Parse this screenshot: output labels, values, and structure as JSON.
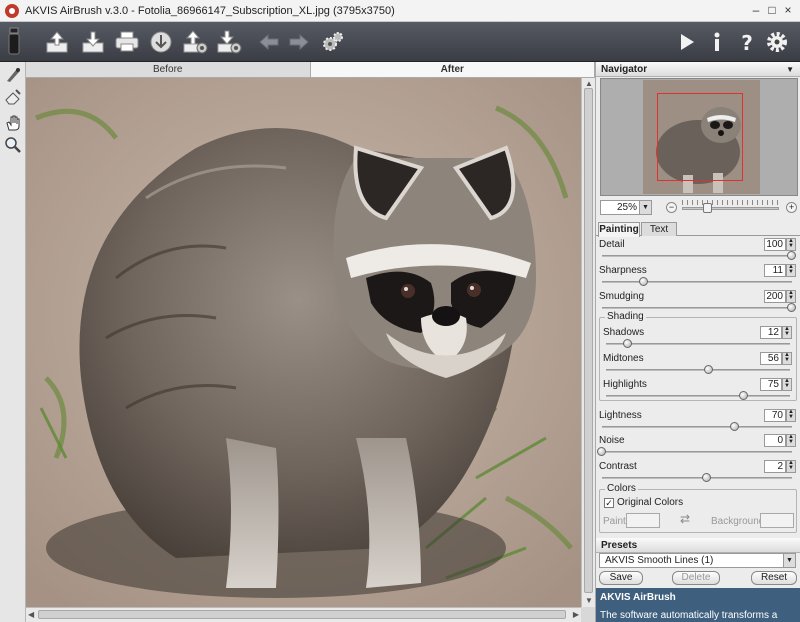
{
  "window": {
    "title": "AKVIS AirBrush v.3.0 - Fotolia_86966147_Subscription_XL.jpg (3795x3750)",
    "controls": {
      "minimize": "–",
      "maximize": "□",
      "close": "×"
    }
  },
  "toolbar": {
    "left_icons": [
      "airbrush-logo-icon",
      "open-image-icon",
      "save-image-icon",
      "print-icon",
      "publish-icon",
      "load-preset-icon",
      "save-preset-icon",
      "undo-arrow-icon",
      "redo-arrow-icon",
      "settings-gears-icon"
    ],
    "right_icons": [
      "run-icon",
      "info-icon",
      "help-icon",
      "preferences-gear-icon"
    ]
  },
  "left_tools": [
    "airbrush-tool-icon",
    "eraser-tool-icon",
    "hand-tool-icon",
    "zoom-tool-icon"
  ],
  "view_tabs": {
    "before": "Before",
    "after": "After"
  },
  "navigator": {
    "title": "Navigator",
    "zoom": "25%",
    "zoom_level": 0.27,
    "minus": "−",
    "plus": "+"
  },
  "panel_tabs": {
    "painting": "Painting",
    "text": "Text"
  },
  "painting": {
    "detail": {
      "label": "Detail",
      "value": "100",
      "fraction": 1.0
    },
    "sharpness": {
      "label": "Sharpness",
      "value": "11",
      "fraction": 0.22
    },
    "smudging": {
      "label": "Smudging",
      "value": "200",
      "fraction": 1.0
    },
    "shading": {
      "label": "Shading",
      "shadows": {
        "label": "Shadows",
        "value": "12",
        "fraction": 0.12
      },
      "midtones": {
        "label": "Midtones",
        "value": "56",
        "fraction": 0.56
      },
      "highlights": {
        "label": "Highlights",
        "value": "75",
        "fraction": 0.75
      }
    },
    "lightness": {
      "label": "Lightness",
      "value": "70",
      "fraction": 0.7
    },
    "noise": {
      "label": "Noise",
      "value": "0",
      "fraction": 0.0
    },
    "contrast": {
      "label": "Contrast",
      "value": "2",
      "fraction": 0.55
    },
    "colors": {
      "label": "Colors",
      "original_colors": "Original Colors",
      "checked": true,
      "paint": "Paint",
      "background": "Background"
    }
  },
  "presets": {
    "title": "Presets",
    "selected": "AKVIS Smooth Lines (1)",
    "save": "Save",
    "delete": "Delete",
    "reset": "Reset"
  },
  "help": {
    "title": "AKVIS AirBrush",
    "text": "The software automatically transforms a"
  },
  "colors": {
    "toolbar_bg": "#474b53",
    "help_bg": "#3f5f7f",
    "navigator_frame": "#e03030"
  }
}
